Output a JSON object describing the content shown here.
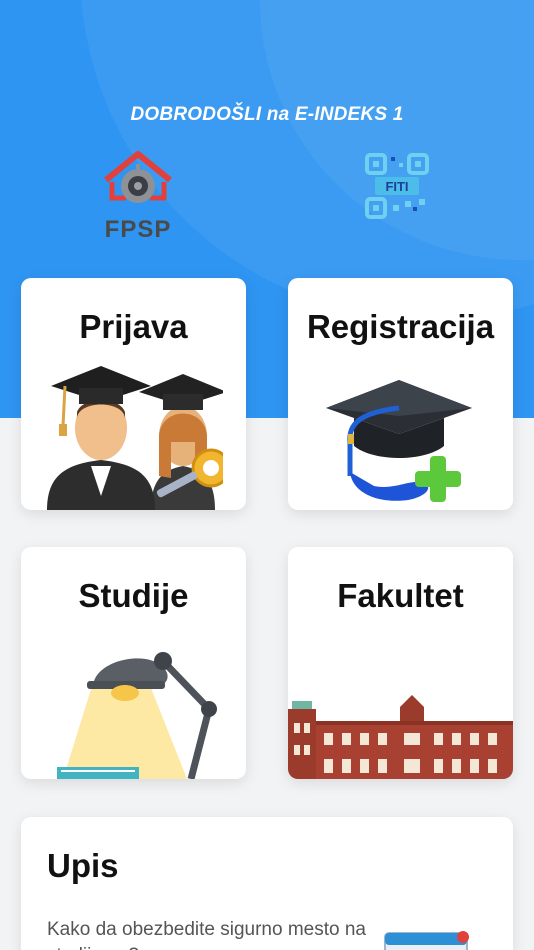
{
  "header": {
    "welcome_text": "DOBRODOŠLI na E-INDEKS 1",
    "logos": [
      {
        "name": "FPSP",
        "text": "FPSP",
        "icon": "camera-house-logo"
      },
      {
        "name": "FITI",
        "text": "FITI",
        "icon": "qr-code-logo"
      }
    ]
  },
  "colors": {
    "hero_blue": "#2f95f2",
    "background": "#f2f3f5",
    "card": "#ffffff"
  },
  "cards": [
    {
      "title": "Prijava",
      "icon": "graduates-key-icon"
    },
    {
      "title": "Registracija",
      "icon": "graduation-cap-plus-icon"
    },
    {
      "title": "Studije",
      "icon": "desk-lamp-icon"
    },
    {
      "title": "Fakultet",
      "icon": "faculty-building-icon"
    }
  ],
  "upis": {
    "title": "Upis",
    "description": "Kako da obezbedite sigurno mesto na studijama?",
    "icon": "calendar-icon"
  }
}
